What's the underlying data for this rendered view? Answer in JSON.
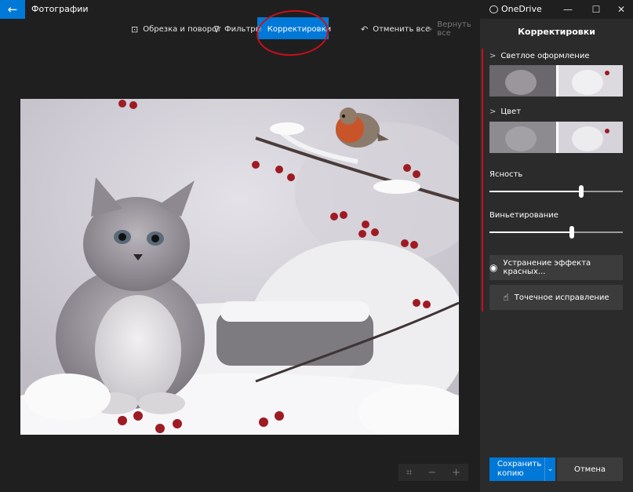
{
  "app": {
    "title": "Фотографии",
    "onedrive": "OneDrive",
    "window_controls": {
      "minimize": "—",
      "maximize": "☐",
      "close": "✕"
    }
  },
  "toolbar": {
    "crop_label": "Обрезка и поворот",
    "filters_label": "Фильтры",
    "adjust_label": "Корректировки",
    "undo_label": "Отменить все",
    "redo_label": "Вернуть все"
  },
  "panel": {
    "title": "Корректировки",
    "light_section": "Светлое оформление",
    "color_section": "Цвет",
    "clarity_label": "Ясность",
    "clarity_value": 0.69,
    "vignette_label": "Виньетирование",
    "vignette_value": 0.62,
    "light_marker": 0.5,
    "color_marker": 0.5,
    "redeye_label": "Устранение эффекта красных...",
    "spotfix_label": "Точечное исправление",
    "save_label_line1": "Сохранить",
    "save_label_line2": "копию",
    "cancel_label": "Отмена"
  },
  "icons": {
    "back": "back-arrow-icon",
    "crop": "crop-icon",
    "filters": "filter-icon",
    "adjust": "sun-icon",
    "undo": "undo-icon",
    "redo": "redo-icon",
    "redeye": "eye-icon",
    "spotfix": "hand-icon"
  },
  "colors": {
    "accent": "#0078d7",
    "annotation": "#c8101a"
  }
}
